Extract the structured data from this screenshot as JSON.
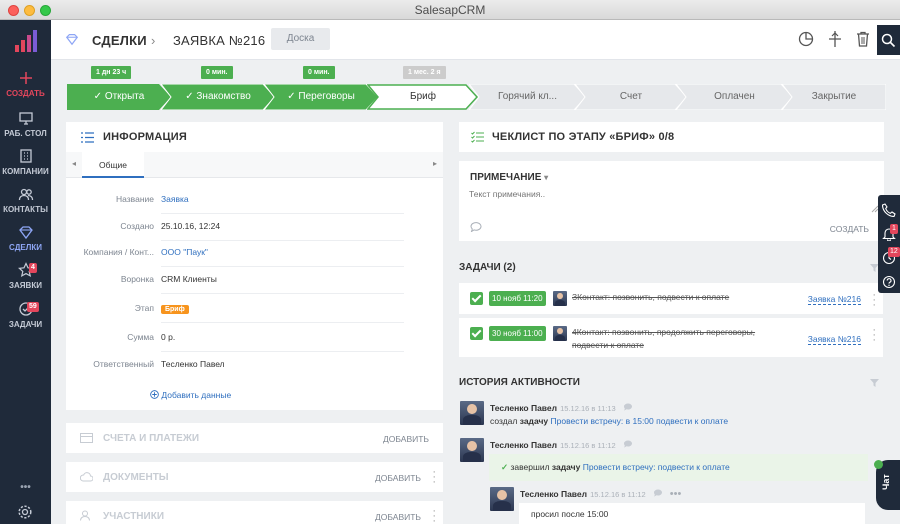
{
  "window": {
    "title": "SalesapCRM"
  },
  "sidebar": {
    "items": [
      {
        "label": "СОЗДАТЬ",
        "icon": "plus-icon"
      },
      {
        "label": "РАБ. СТОЛ",
        "icon": "desktop-icon"
      },
      {
        "label": "КОМПАНИИ",
        "icon": "building-icon"
      },
      {
        "label": "КОНТАКТЫ",
        "icon": "contacts-icon"
      },
      {
        "label": "СДЕЛКИ",
        "icon": "diamond-icon"
      },
      {
        "label": "ЗАЯВКИ",
        "icon": "star-icon",
        "badge": "4"
      },
      {
        "label": "ЗАДАЧИ",
        "icon": "check-icon",
        "badge": "59"
      }
    ],
    "more": "•••",
    "settings_icon": "gear-icon"
  },
  "header": {
    "section": "СДЕЛКИ",
    "separator": "›",
    "title": "ЗАЯВКА №216",
    "board_button": "Доска"
  },
  "pipeline": {
    "stages": [
      {
        "label": "✓ Открыта",
        "time": "1 дн 23 ч",
        "state": "done"
      },
      {
        "label": "✓ Знакомство",
        "time": "0 мин.",
        "state": "done"
      },
      {
        "label": "✓ Переговоры",
        "time": "0 мин.",
        "state": "done"
      },
      {
        "label": "Бриф",
        "time": "1 мес. 2 я",
        "state": "current"
      },
      {
        "label": "Горячий кл...",
        "time": "",
        "state": "todo"
      },
      {
        "label": "Счет",
        "time": "",
        "state": "todo"
      },
      {
        "label": "Оплачен",
        "time": "",
        "state": "todo"
      },
      {
        "label": "Закрытие",
        "time": "",
        "state": "todo"
      }
    ]
  },
  "info": {
    "title": "ИНФОРМАЦИЯ",
    "tab": "Общие",
    "fields": [
      {
        "label": "Название",
        "value": "Заявка",
        "kind": "link"
      },
      {
        "label": "Создано",
        "value": "25.10.16, 12:24",
        "kind": "text"
      },
      {
        "label": "Компания / Конт...",
        "value": "ООО \"Паук\"",
        "kind": "link"
      },
      {
        "label": "Воронка",
        "value": "CRM Клиенты",
        "kind": "text"
      },
      {
        "label": "Этап",
        "value": "Бриф",
        "kind": "tag"
      },
      {
        "label": "Сумма",
        "value": "0 р.",
        "kind": "text"
      },
      {
        "label": "Ответственный",
        "value": "Тесленко Павел",
        "kind": "text"
      }
    ],
    "add_data": "Добавить данные"
  },
  "collapsed_sections": [
    {
      "title": "СЧЕТА И ПЛАТЕЖИ",
      "action": "ДОБАВИТЬ"
    },
    {
      "title": "ДОКУМЕНТЫ",
      "action": "ДОБАВИТЬ"
    },
    {
      "title": "УЧАСТНИКИ",
      "action": "ДОБАВИТЬ"
    }
  ],
  "checklist": {
    "title": "ЧЕКЛИСТ ПО ЭТАПУ «БРИФ» 0/8"
  },
  "note": {
    "title": "ПРИМЕЧАНИЕ",
    "placeholder": "Текст примечания..",
    "create": "СОЗДАТЬ"
  },
  "tasks": {
    "title": "ЗАДАЧИ (2)",
    "items": [
      {
        "date": "10 нояб 11:20",
        "text": "ЗКонтакт: позвонить, подвести к оплате",
        "text2": "",
        "link": "Заявка №216"
      },
      {
        "date": "30 нояб 11:00",
        "text": "4Контакт: позвонить, продолжить переговоры,",
        "text2": "подвести к оплате",
        "link": "Заявка №216"
      }
    ]
  },
  "history": {
    "title": "ИСТОРИЯ АКТИВНОСТИ",
    "entries": [
      {
        "name": "Тесленко Павел",
        "time": "15.12.16 в 11:13",
        "pre": "создал",
        "bold": "задачу",
        "link": "Провести встречу: в 15:00 подвести к оплате"
      },
      {
        "name": "Тесленко Павел",
        "time": "15.12.16 в 11:12",
        "pre": "завершил",
        "bold": "задачу",
        "link": "Провести встречу: подвести к оплате"
      },
      {
        "name": "Тесленко Павел",
        "time": "15.12.16 в 11:12",
        "comment": "просил после 15:00"
      }
    ]
  },
  "dock": {
    "badge1": "1",
    "badge2": "12"
  },
  "chat": {
    "label": "Чат"
  },
  "colors": {
    "sidebar": "#1f2a3a",
    "accent_green": "#4caf50",
    "link": "#2f6fbf",
    "stage_orange": "#f7941d",
    "badge_red": "#e3465c"
  }
}
